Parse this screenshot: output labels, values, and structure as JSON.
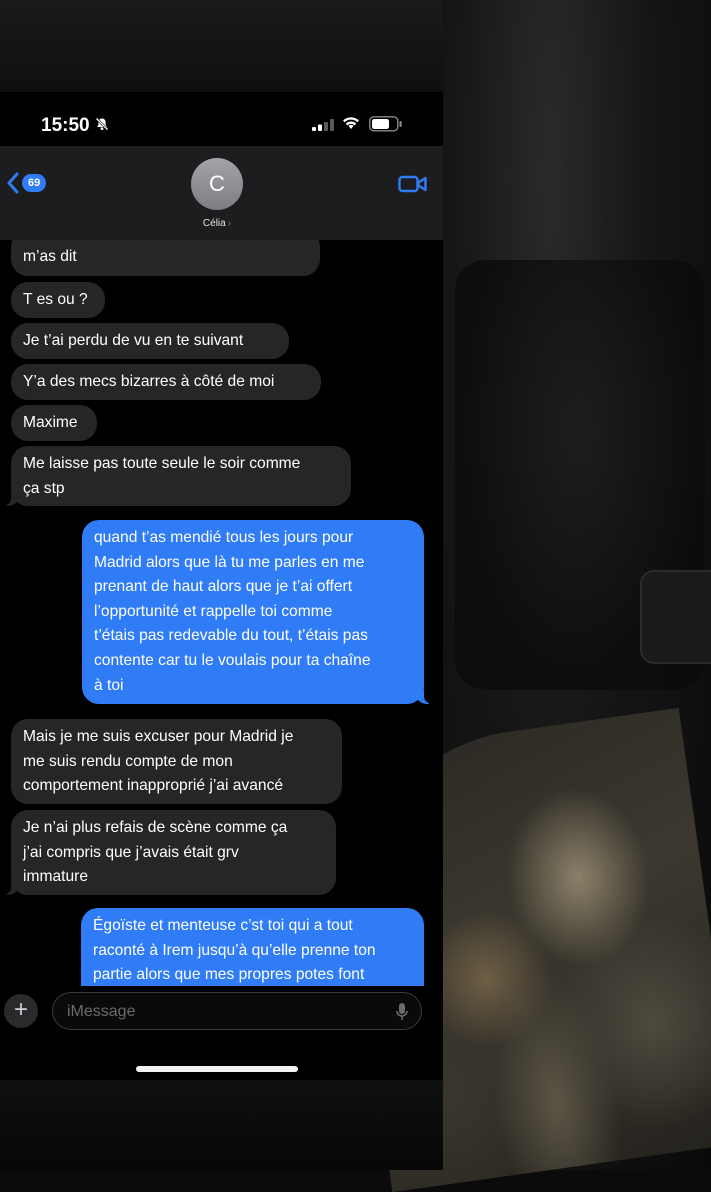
{
  "status_bar": {
    "time": "15:50"
  },
  "header": {
    "back_count": "69",
    "avatar_initial": "C",
    "contact_name": "Célia"
  },
  "messages": [
    {
      "type": "in",
      "lines": [
        "m’as dit"
      ]
    },
    {
      "type": "in",
      "lines": [
        "T es ou ?"
      ]
    },
    {
      "type": "in",
      "lines": [
        "Je t’ai perdu de vu en te suivant"
      ]
    },
    {
      "type": "in",
      "lines": [
        "Y’a des mecs bizarres à côté de moi"
      ]
    },
    {
      "type": "in",
      "lines": [
        "Maxime"
      ]
    },
    {
      "type": "in",
      "lines": [
        "Me laisse pas toute seule le soir comme",
        "ça stp"
      ]
    },
    {
      "type": "out",
      "lines": [
        "quand t’as mendié tous les jours pour",
        "Madrid alors que là tu me parles en me",
        "prenant de haut alors que je t’ai offert",
        "l’opportunité et rappelle toi comme",
        "t’étais pas redevable du tout, t’étais pas",
        "contente car tu le voulais pour ta chaîne",
        "à toi"
      ]
    },
    {
      "type": "in",
      "lines": [
        "Mais je me suis excuser pour Madrid je",
        "me suis rendu compte de mon",
        "comportement inapproprié j’ai avancé"
      ]
    },
    {
      "type": "in",
      "lines": [
        "Je n’ai plus refais de scène comme ça",
        "j’ai compris que j’avais était grv",
        "immature"
      ]
    },
    {
      "type": "out",
      "lines": [
        "Égoïste et menteuse c’st toi qui a tout",
        "raconté à Irem jusqu’à qu’elle prenne ton",
        "partie alors que mes propres potes font"
      ]
    }
  ],
  "input": {
    "placeholder": "iMessage",
    "plus_label": "+"
  },
  "colors": {
    "outgoing": "#2f7cf6",
    "incoming": "#262629",
    "background": "#000000"
  },
  "icons": [
    "bell-slash-icon",
    "signal-icon",
    "wifi-icon",
    "battery-icon",
    "chevron-left-icon",
    "video-camera-icon",
    "microphone-icon"
  ]
}
